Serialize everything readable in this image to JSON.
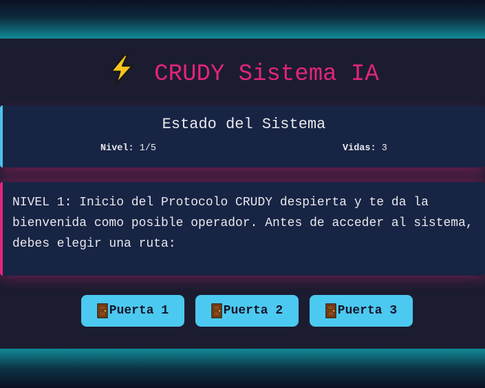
{
  "header": {
    "title": "CRUDY Sistema IA",
    "icon": "lightning-icon"
  },
  "status": {
    "title": "Estado del Sistema",
    "level_label": "Nivel:",
    "level_value": "1/5",
    "lives_label": "Vidas:",
    "lives_value": "3"
  },
  "story": {
    "text": "NIVEL 1: Inicio del Protocolo CRUDY despierta y te da la bienvenida como posible operador. Antes de acceder al sistema, debes elegir una ruta:"
  },
  "doors": [
    {
      "label": "Puerta 1",
      "icon": "door-icon"
    },
    {
      "label": "Puerta 2",
      "icon": "door-icon"
    },
    {
      "label": "Puerta 3",
      "icon": "door-icon"
    }
  ],
  "colors": {
    "background": "#1c1c30",
    "accent_pink": "#e2257b",
    "accent_cyan": "#4cc9f0",
    "panel": "#172444"
  }
}
